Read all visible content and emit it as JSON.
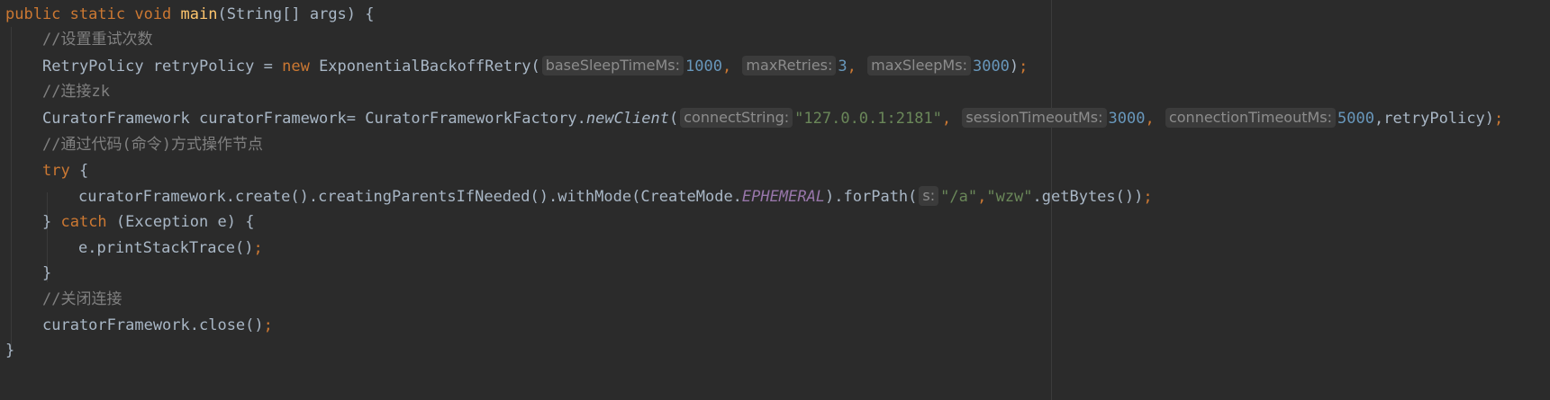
{
  "code": {
    "l1": {
      "kw1": "public",
      "kw2": "static",
      "kw3": "void",
      "fn": "main",
      "rest": "(String[] args) {"
    },
    "l2": {
      "comment": "//设置重试次数"
    },
    "l3": {
      "t1": "RetryPolicy retryPolicy = ",
      "kw": "new",
      "t2": " ExponentialBackoffRetry(",
      "h1": "baseSleepTimeMs:",
      "n1": "1000",
      ",1": ", ",
      "h2": "maxRetries:",
      "n2": "3",
      ",2": ", ",
      "h3": "maxSleepMs:",
      "n3": "3000",
      "end1": ")",
      "semi": ";"
    },
    "l4": {
      "comment": "//连接zk"
    },
    "l5": {
      "t1": "CuratorFramework curatorFramework= CuratorFrameworkFactory.",
      "fn": "newClient",
      "t2": "(",
      "h1": "connectString:",
      "s1": "\"127.0.0.1:2181\"",
      "c1": ", ",
      "h2": "sessionTimeoutMs:",
      "n1": "3000",
      "c2": ", ",
      "h3": "connectionTimeoutMs:",
      "n2": "5000",
      "t3": ",retryPolicy)",
      "semi": ";"
    },
    "l6": {
      "comment": "//通过代码(命令)方式操作节点"
    },
    "l7": {
      "kw": "try",
      "rest": " {"
    },
    "l8": {
      "t1": "curatorFramework.create().creatingParentsIfNeeded().withMode(CreateMode.",
      "const": "EPHEMERAL",
      "t2": ").forPath(",
      "h1": "s:",
      "s1": "\"/a\"",
      "c1": ",",
      "s2": "\"wzw\"",
      "t3": ".getBytes())",
      "semi": ";"
    },
    "l9": {
      "t1": "} ",
      "kw": "catch",
      "t2": " (Exception e) {"
    },
    "l10": {
      "t1": "e.printStackTrace()",
      "semi": ";"
    },
    "l11": {
      "t1": "}"
    },
    "l12": {
      "comment": "//关闭连接"
    },
    "l13": {
      "t1": "curatorFramework.close()",
      "semi": ";"
    },
    "l14": {
      "t1": "}"
    }
  }
}
